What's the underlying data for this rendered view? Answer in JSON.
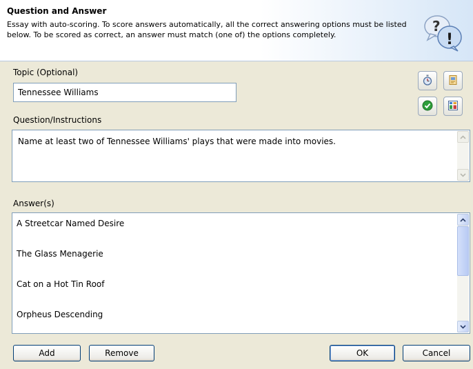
{
  "header": {
    "title": "Question and Answer",
    "description": "Essay with auto-scoring. To score answers automatically, all the correct answering options must be listed below. To be scored as correct, an answer must match (one of) the options completely.",
    "icon": "question-exclamation-bubbles-icon"
  },
  "topic": {
    "label": "Topic (Optional)",
    "value": "Tennessee Williams"
  },
  "question": {
    "label": "Question/Instructions",
    "value": "Name at least two of Tennessee Williams' plays that were made into movies."
  },
  "toolbar": {
    "timer_icon": "stopwatch-icon",
    "media_icon": "media-file-icon",
    "feedback_icon": "green-check-icon",
    "layout_icon": "layout-grid-icon"
  },
  "answers": {
    "label": "Answer(s)",
    "items": [
      "A Streetcar Named Desire",
      "The Glass Menagerie",
      "Cat on a Hot Tin Roof",
      "Orpheus Descending"
    ]
  },
  "buttons": {
    "add": "Add",
    "remove": "Remove",
    "ok": "OK",
    "cancel": "Cancel"
  },
  "colors": {
    "window_bg": "#ece9d8",
    "header_gradient_end": "#d6e6f7",
    "field_border": "#7f9db9",
    "button_border": "#003c74"
  }
}
